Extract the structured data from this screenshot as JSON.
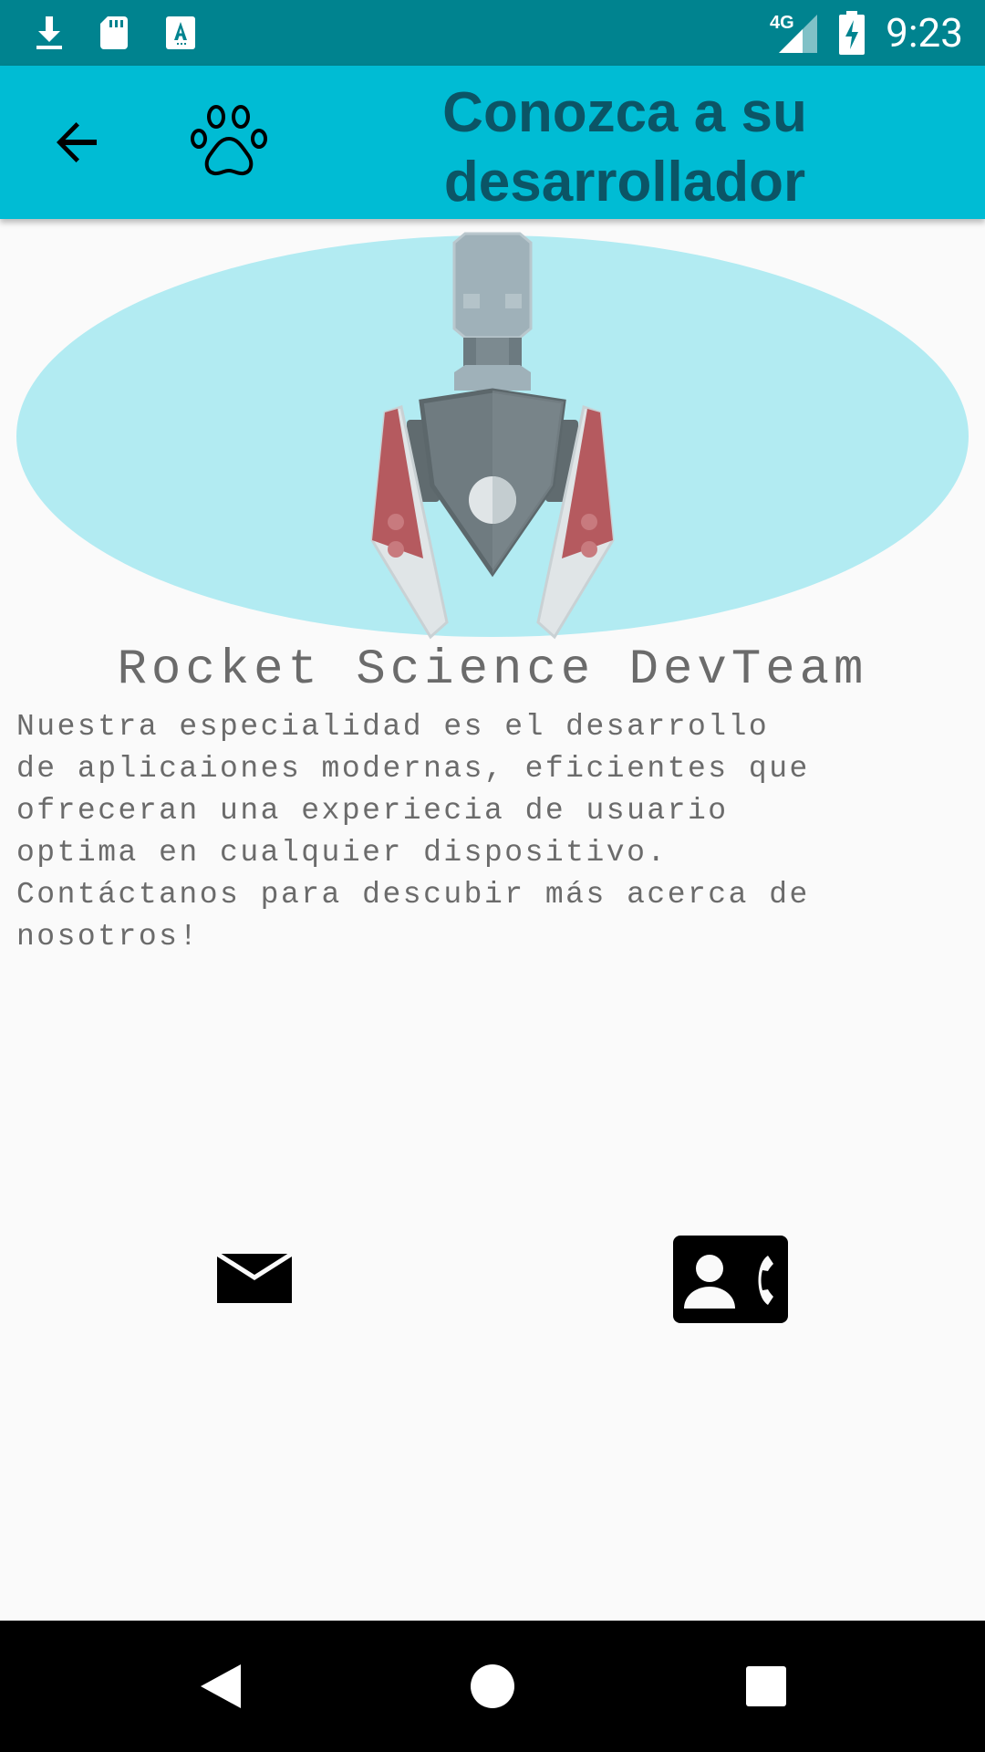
{
  "status_bar": {
    "time": "9:23",
    "network": "4G",
    "icons": [
      "download-icon",
      "sd-card-icon",
      "text-app-icon",
      "signal-icon",
      "battery-charging-icon"
    ]
  },
  "app_bar": {
    "title": "Conozca a su desarrollador",
    "icons": [
      "back-arrow-icon",
      "paw-icon"
    ],
    "color": "#00bcd4",
    "title_color": "#0b5566"
  },
  "content": {
    "team_name": "Rocket Science DevTeam",
    "description": "Nuestra especialidad es el desarrollo\nde aplicaiones modernas, eficientes que\nofreceran una experiecia de usuario\noptima en cualquier dispositivo.\nContáctanos para descubir más acerca de\nnosotros!",
    "hero_icon": "rocket-icon",
    "actions": [
      "email-icon",
      "contact-phone-icon"
    ]
  },
  "nav_bar": {
    "icons": [
      "nav-back-icon",
      "nav-home-icon",
      "nav-recents-icon"
    ]
  }
}
